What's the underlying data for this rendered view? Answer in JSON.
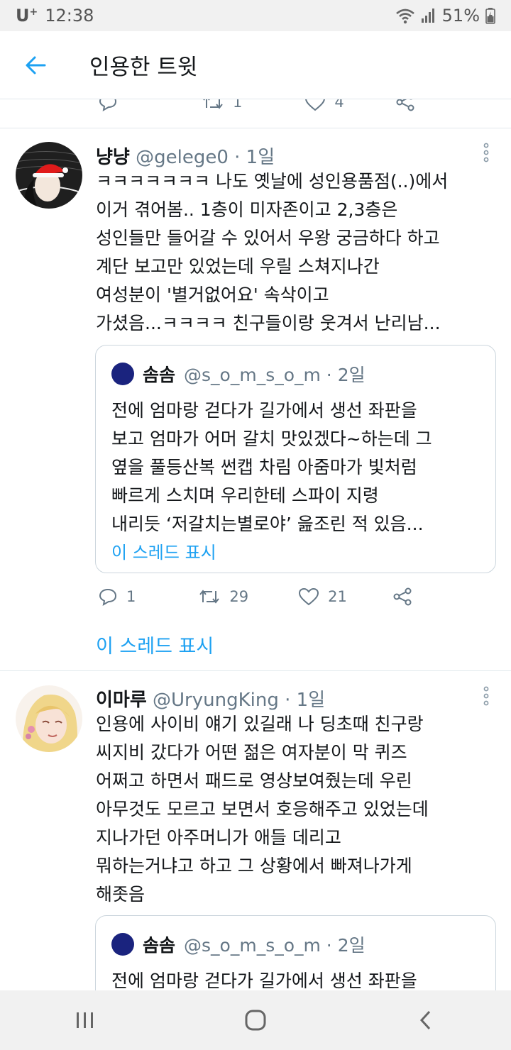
{
  "status_bar": {
    "carrier": "U",
    "carrier_sup": "+",
    "time": "12:38",
    "battery": "51%"
  },
  "header": {
    "title": "인용한 트윗"
  },
  "colors": {
    "accent": "#1da1f2",
    "text": "#14171a",
    "secondary": "#657786",
    "quote_dot": "#1a237e"
  },
  "top_partial_actions": {
    "reply_count": "",
    "retweet_count": "1",
    "like_count": "4"
  },
  "tweets": [
    {
      "name": "냥냥",
      "meta": " @gelege0 · 1일",
      "lines": [
        "ㅋㅋㅋㅋㅋㅋㅋ 나도 옛날에 성인용품점(..)에서",
        "이거 겪어봄.. 1층이 미자존이고 2,3층은",
        "성인들만 들어갈 수 있어서 우왕 궁금하다 하고",
        "계단 보고만 있었는데 우릴 스쳐지나간",
        "여성분이 '별거없어요' 속삭이고",
        "가셨음...ㅋㅋㅋㅋ 친구들이랑 웃겨서 난리남..."
      ],
      "quote": {
        "name": "솜솜",
        "meta": "@s_o_m_s_o_m · 2일",
        "lines": [
          "전에 엄마랑 걷다가 길가에서 생선 좌판을",
          "보고 엄마가 어머 갈치 맛있겠다~하는데 그",
          "옆을 풀등산복 썬캡 차림 아줌마가 빛처럼",
          "빠르게 스치며 우리한테 스파이 지령",
          "내리듯 ‘저갈치는별로야’ 읊조린 적 있음..."
        ],
        "show_thread": "이 스레드 표시"
      },
      "reply_count": "1",
      "retweet_count": "29",
      "like_count": "21",
      "show_thread": "이 스레드 표시"
    },
    {
      "name": "이마루",
      "meta": " @UryungKing · 1일",
      "lines": [
        "인용에 사이비 얘기 있길래 나 딩초때 친구랑",
        "씨지비 갔다가 어떤 젊은 여자분이 막 퀴즈",
        "어쩌고 하면서 패드로 영상보여줬는데 우린",
        "아무것도 모르고 보면서 호응해주고 있었는데",
        "지나가던 아주머니가 애들 데리고",
        "뭐하는거냐고 하고 그 상황에서 빠져나가게",
        "해좃음"
      ],
      "quote": {
        "name": "솜솜",
        "meta": "@s_o_m_s_o_m · 2일",
        "lines": [
          "전에 엄마랑 걷다가 길가에서 생선 좌판을"
        ]
      }
    }
  ]
}
